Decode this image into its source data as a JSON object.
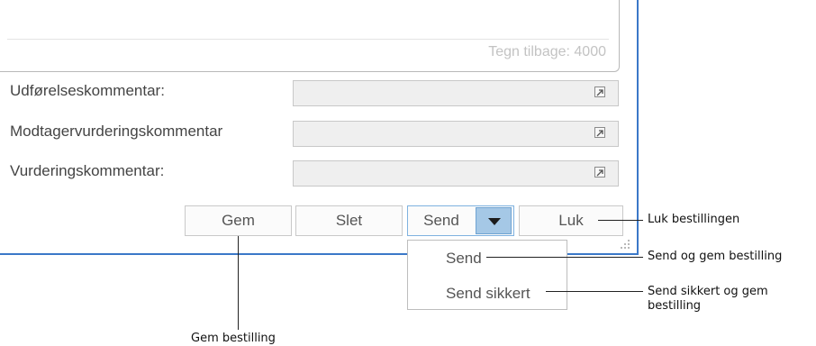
{
  "textarea": {
    "char_counter": "Tegn tilbage: 4000"
  },
  "fields": [
    {
      "label": "Udførelseskommentar:",
      "value": ""
    },
    {
      "label": "Modtagervurderingskommentar",
      "value": ""
    },
    {
      "label": "Vurderingskommentar:",
      "value": ""
    }
  ],
  "buttons": {
    "gem": "Gem",
    "slet": "Slet",
    "send": "Send",
    "luk": "Luk"
  },
  "send_menu": {
    "items": [
      "Send",
      "Send sikkert"
    ]
  },
  "callouts": {
    "luk": "Luk bestillingen",
    "send": "Send og gem bestilling",
    "send_sikkert": "Send sikkert og gem bestilling",
    "gem": "Gem bestilling"
  },
  "colors": {
    "window_border": "#3b78c8",
    "dropdown_arrow_bg": "#a5c8e6",
    "field_bg": "#efefef"
  },
  "icons": {
    "field_expand": "expand-arrow-icon",
    "send_dropdown": "triangle-down-icon",
    "resize": "resize-grip-icon"
  }
}
